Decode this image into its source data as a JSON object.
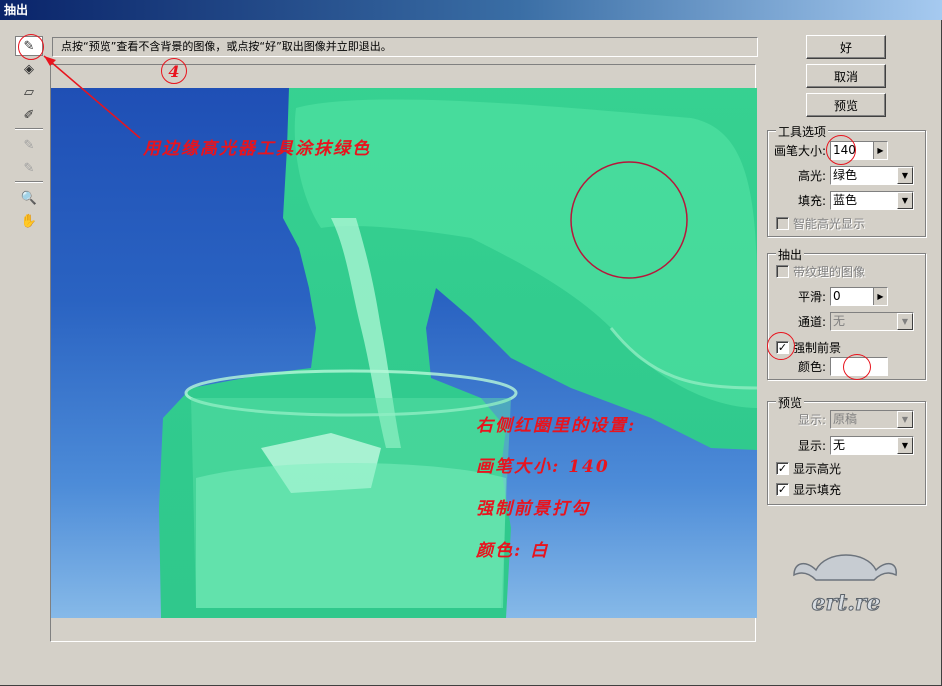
{
  "window": {
    "title": "抽出"
  },
  "hint": {
    "text": "点按“预览”查看不含背景的图像，或点按“好”取出图像并立即退出。"
  },
  "tools": [
    {
      "icon": "edge-highlighter-icon",
      "glyph": "✎",
      "selected": true,
      "enabled": true
    },
    {
      "icon": "fill-bucket-icon",
      "glyph": "◈",
      "selected": false,
      "enabled": true
    },
    {
      "icon": "eraser-icon",
      "glyph": "▱",
      "selected": false,
      "enabled": true
    },
    {
      "icon": "eyedropper-icon",
      "glyph": "✐",
      "selected": false,
      "enabled": true
    },
    {
      "icon": "cleanup-tool-icon",
      "glyph": "✎",
      "selected": false,
      "enabled": false
    },
    {
      "icon": "edge-touchup-icon",
      "glyph": "✎",
      "selected": false,
      "enabled": false
    },
    {
      "icon": "zoom-icon",
      "glyph": "🔍",
      "selected": false,
      "enabled": true
    },
    {
      "icon": "hand-icon",
      "glyph": "✋",
      "selected": false,
      "enabled": true
    }
  ],
  "buttons": {
    "ok": "好",
    "cancel": "取消",
    "preview": "预览"
  },
  "tool_options": {
    "title": "工具选项",
    "brush_size_label": "画笔大小:",
    "brush_size": "140",
    "highlight_label": "高光:",
    "highlight_value": "绿色",
    "fill_label": "填充:",
    "fill_value": "蓝色",
    "smart_highlight_label": "智能高光显示",
    "smart_highlight_checked": false
  },
  "extract": {
    "title": "抽出",
    "textured_label": "带纹理的图像",
    "smooth_label": "平滑:",
    "smooth_value": "0",
    "channel_label": "通道:",
    "channel_value": "无",
    "force_fg_label": "强制前景",
    "force_fg_checked": true,
    "color_label": "颜色:",
    "color_value": "#ffffff"
  },
  "preview": {
    "title": "预览",
    "show1_label": "显示:",
    "show1_value": "原稿",
    "show2_label": "显示:",
    "show2_value": "无",
    "show_highlight_label": "显示高光",
    "show_highlight_checked": true,
    "show_fill_label": "显示填充",
    "show_fill_checked": true
  },
  "annotations": {
    "step_number": "4",
    "arrow_note": "用边缘高光器工具涂抹绿色",
    "settings_title": "右侧红圈里的设置:",
    "settings_brush": "画笔大小: 140",
    "settings_force": "强制前景打勾",
    "settings_color": "颜色: 白"
  },
  "logo": {
    "text": "ert.re"
  },
  "colors": {
    "annotation_red": "#e8141e",
    "highlight_green": "#3ad888",
    "background_blue": "#2a63c2"
  }
}
